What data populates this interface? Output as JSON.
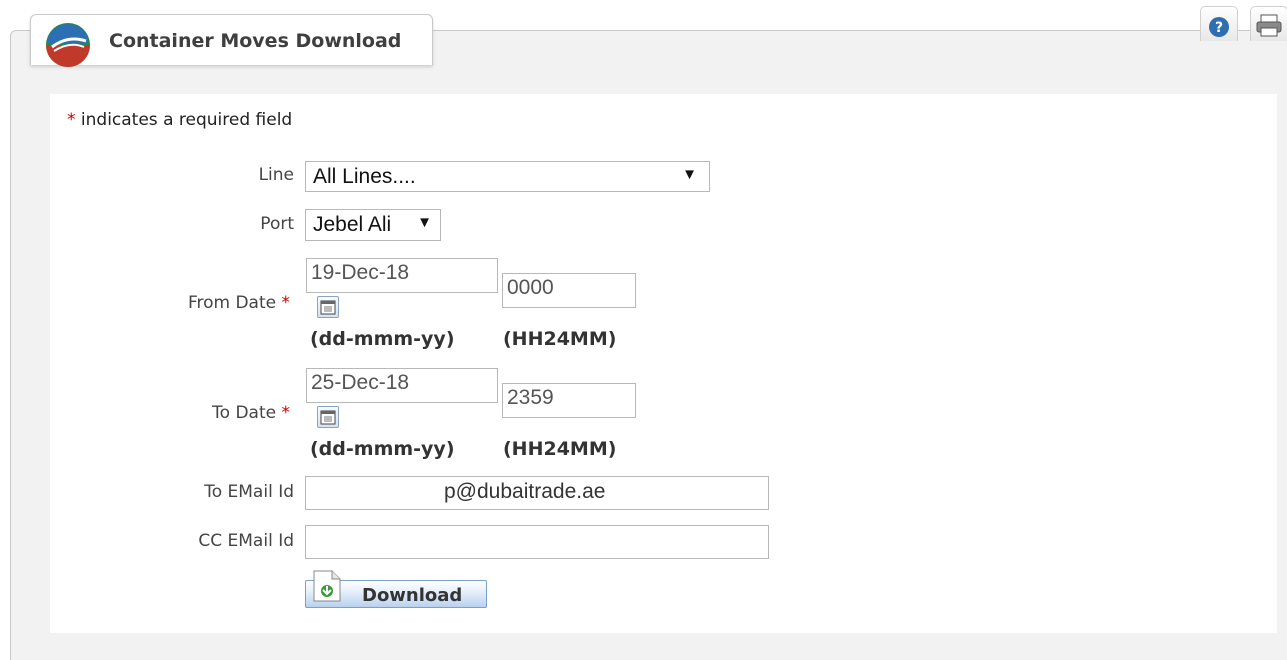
{
  "header": {
    "title": "Container Moves Download",
    "icons": [
      "help-icon",
      "print-icon"
    ]
  },
  "form": {
    "required_note": "indicates a required field",
    "required_mark": "*",
    "line": {
      "label": "Line",
      "value": "All Lines...."
    },
    "port": {
      "label": "Port",
      "value": "Jebel Ali"
    },
    "from_date": {
      "label": "From Date",
      "date": "19-Dec-18",
      "time": "0000"
    },
    "to_date": {
      "label": "To Date",
      "date": "25-Dec-18",
      "time": "2359"
    },
    "date_format": "(dd-mmm-yy)",
    "time_format": "(HH24MM)",
    "to_email": {
      "label": "To EMail Id",
      "value": "p@dubaitrade.ae"
    },
    "cc_email": {
      "label": "CC EMail Id",
      "value": ""
    },
    "download_label": "Download"
  },
  "colors": {
    "required": "#cc0000",
    "panel_bg": "#f2f2f2",
    "button_border": "#7aa1c9"
  }
}
